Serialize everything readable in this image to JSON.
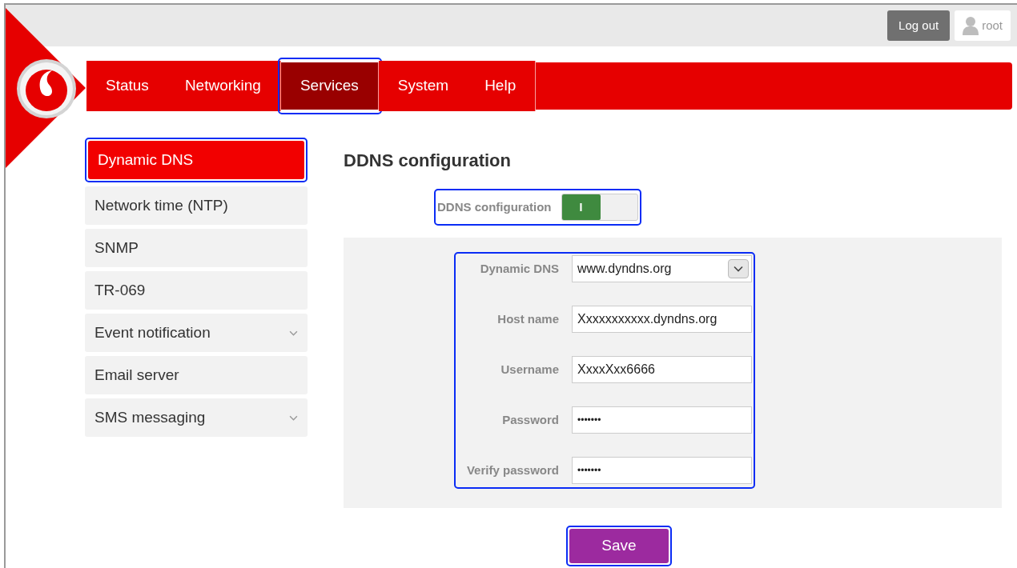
{
  "header": {
    "logout_button": "Log out",
    "user": "root"
  },
  "tabs": [
    {
      "label": "Status",
      "selected": false,
      "highlighted": false
    },
    {
      "label": "Networking",
      "selected": false,
      "highlighted": false
    },
    {
      "label": "Services",
      "selected": true,
      "highlighted": true
    },
    {
      "label": "System",
      "selected": false,
      "highlighted": false
    },
    {
      "label": "Help",
      "selected": false,
      "highlighted": false
    }
  ],
  "sidebar": {
    "items": [
      {
        "label": "Dynamic DNS",
        "selected": true,
        "expandable": false,
        "highlighted": true
      },
      {
        "label": "Network time (NTP)",
        "selected": false,
        "expandable": false,
        "highlighted": false
      },
      {
        "label": "SNMP",
        "selected": false,
        "expandable": false,
        "highlighted": false
      },
      {
        "label": "TR-069",
        "selected": false,
        "expandable": false,
        "highlighted": false
      },
      {
        "label": "Event notification",
        "selected": false,
        "expandable": true,
        "highlighted": false
      },
      {
        "label": "Email server",
        "selected": false,
        "expandable": false,
        "highlighted": false
      },
      {
        "label": "SMS messaging",
        "selected": false,
        "expandable": true,
        "highlighted": false
      }
    ]
  },
  "content": {
    "title": "DDNS configuration",
    "toggle": {
      "label": "DDNS configuration",
      "on": true,
      "on_text": "I",
      "highlighted": true
    },
    "form": {
      "highlighted": true,
      "fields": [
        {
          "label": "Dynamic DNS",
          "kind": "select",
          "value": "www.dyndns.org"
        },
        {
          "label": "Host name",
          "kind": "text",
          "value": "Xxxxxxxxxxx.dyndns.org"
        },
        {
          "label": "Username",
          "kind": "text",
          "value": "XxxxXxx6666"
        },
        {
          "label": "Password",
          "kind": "password",
          "value": "•••••••"
        },
        {
          "label": "Verify password",
          "kind": "password",
          "value": "•••••••"
        }
      ]
    },
    "save_button": {
      "label": "Save",
      "highlighted": true
    }
  }
}
